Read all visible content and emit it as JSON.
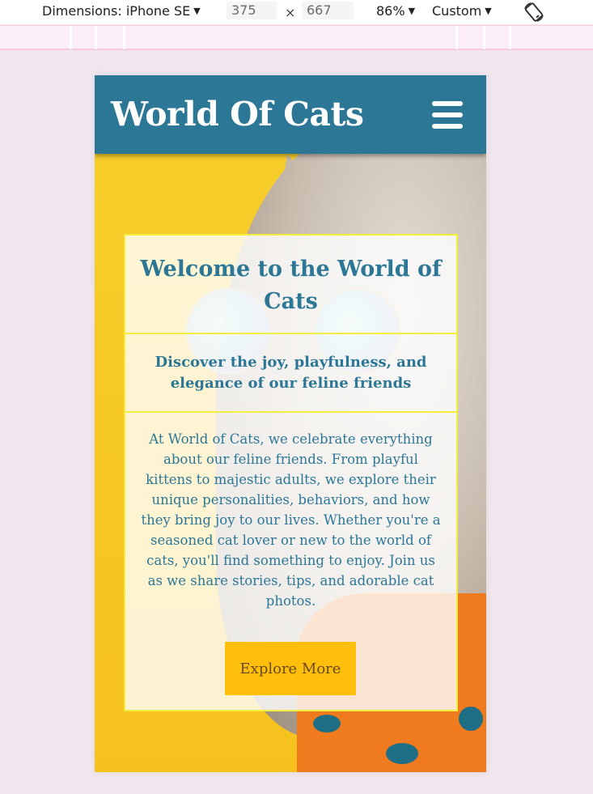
{
  "devtools": {
    "dimensions_label": "Dimensions: iPhone SE",
    "width": "375",
    "times": "×",
    "height": "667",
    "zoom": "86%",
    "throttle": "Custom",
    "caret": "▼"
  },
  "site": {
    "title": "World Of Cats",
    "menu_icon": "hamburger-menu-icon"
  },
  "hero": {
    "heading": "Welcome to the World of Cats",
    "tagline": "Discover the joy, playfulness, and elegance of our feline friends",
    "body": "At World of Cats, we celebrate everything about our feline friends. From playful kittens to majestic adults, we explore their unique personalities, behaviors, and how they bring joy to our lives. Whether you're a seasoned cat lover or new to the world of cats, you'll find something to enjoy. Join us as we share stories, tips, and adorable cat photos.",
    "cta_label": "Explore More"
  },
  "colors": {
    "header_bg": "#2c7796",
    "accent_text": "#2c7796",
    "button_bg": "#ffbf0a",
    "card_border": "#f2ee3e",
    "page_bg": "#f1e6ee"
  }
}
